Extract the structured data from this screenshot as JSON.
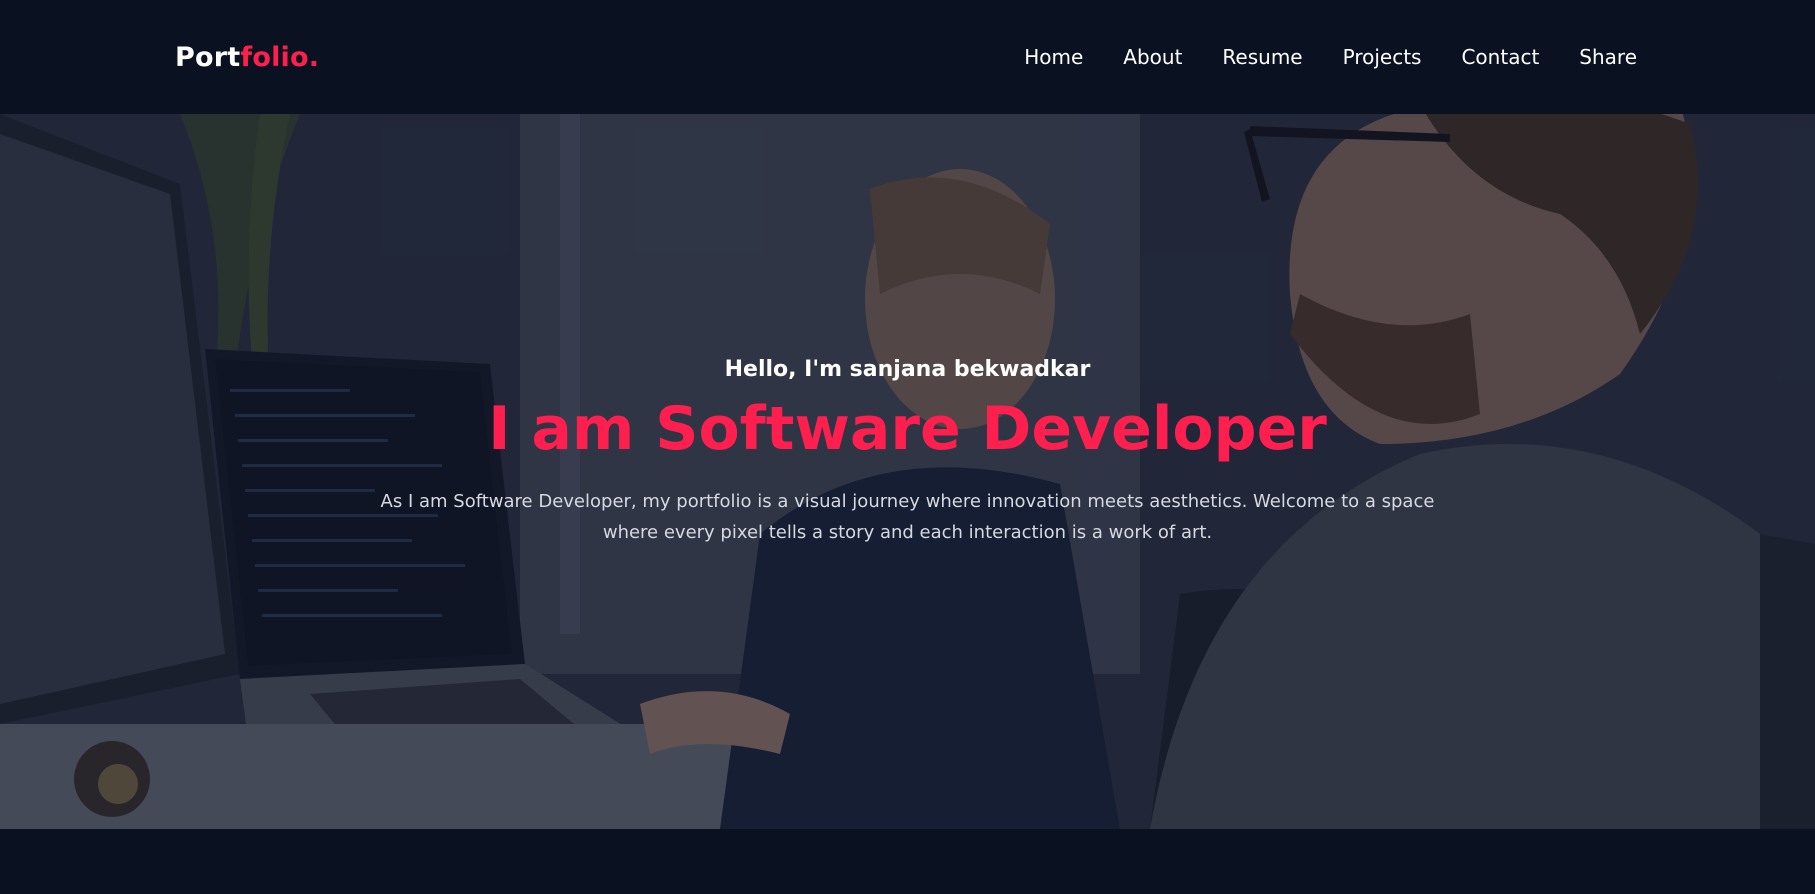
{
  "logo": {
    "main": "Port",
    "accent": "folio."
  },
  "nav": {
    "home": "Home",
    "about": "About",
    "resume": "Resume",
    "projects": "Projects",
    "contact": "Contact",
    "share": "Share"
  },
  "hero": {
    "greeting": "Hello, I'm sanjana bekwadkar",
    "headline": "I am Software Developer",
    "description": "As I am Software Developer, my portfolio is a visual journey where innovation meets aesthetics. Welcome to a space where every pixel tells a story and each interaction is a work of art."
  },
  "colors": {
    "background": "#0a1222",
    "accent": "#ff1f4f",
    "text": "#ffffff"
  }
}
